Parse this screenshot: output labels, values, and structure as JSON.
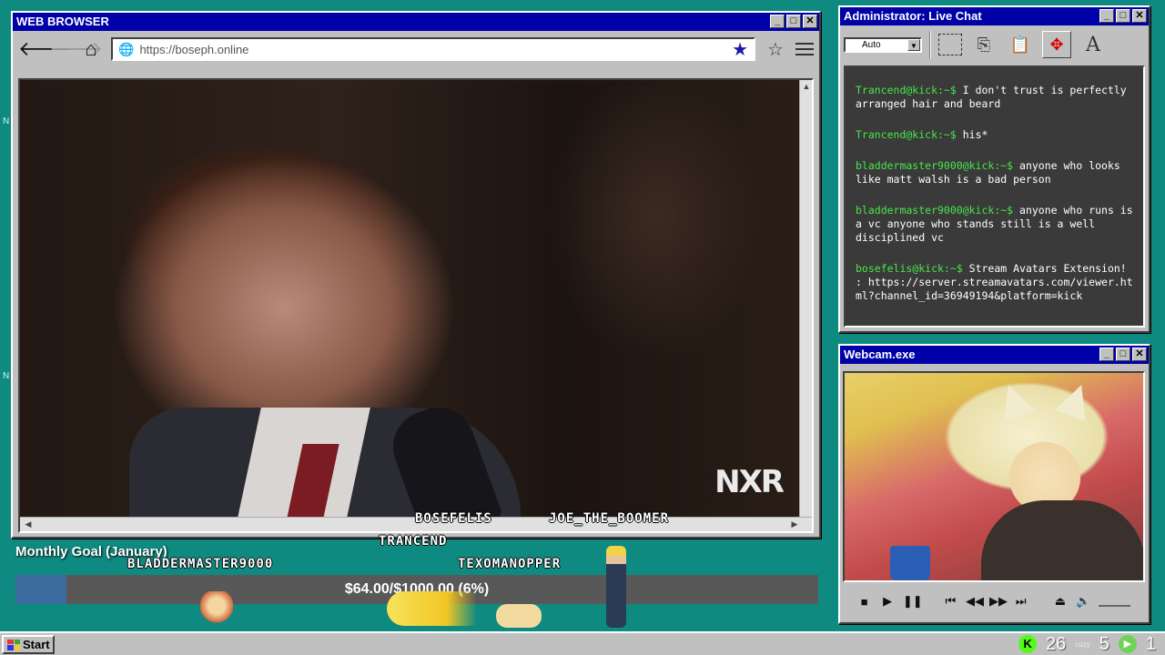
{
  "browser": {
    "title": "WEB BROWSER",
    "url": "https://boseph.online",
    "controls": {
      "minimize": "_",
      "maximize": "□",
      "close": "✕"
    },
    "video_watermark": "NXR"
  },
  "chat": {
    "title": "Administrator: Live Chat",
    "zoom_value": "Auto",
    "font_tool": "A",
    "messages": [
      {
        "user": "Trancend@kick:~$",
        "text": "I don't trust is perfectly arranged hair and beard"
      },
      {
        "user": "Trancend@kick:~$",
        "text": "his*"
      },
      {
        "user": "bladdermaster9000@kick:~$",
        "text": "anyone who looks like matt walsh is a bad person"
      },
      {
        "user": "bladdermaster9000@kick:~$",
        "text": "anyone who runs is a vc anyone who stands still is a well disciplined vc"
      },
      {
        "user": "bosefelis@kick:~$",
        "text": "Stream Avatars Extension! : https://server.streamavatars.com/viewer.html?channel_id=36949194&platform=kick"
      }
    ]
  },
  "webcam": {
    "title": "Webcam.exe"
  },
  "goal": {
    "title": "Monthly Goal (January)",
    "amount_text": "$64.00/$1000.00 (6%)",
    "progress_fraction": 0.064
  },
  "avatars": [
    {
      "name": "BOSEFELIS"
    },
    {
      "name": "JOE_THE_BOOMER"
    },
    {
      "name": "TRANCEND"
    },
    {
      "name": "BLADDERMASTER9000"
    },
    {
      "name": "TEXOMANOPPER"
    }
  ],
  "taskbar": {
    "start_label": "Start",
    "tray": {
      "viewers": "26",
      "cozy": "cozy",
      "count2": "5",
      "count3": "1"
    }
  },
  "colors": {
    "desktop": "#0f8a80",
    "titlebar": "#0000a8",
    "chat_user": "#48e64a",
    "goal_fill": "#3c6c9e"
  }
}
